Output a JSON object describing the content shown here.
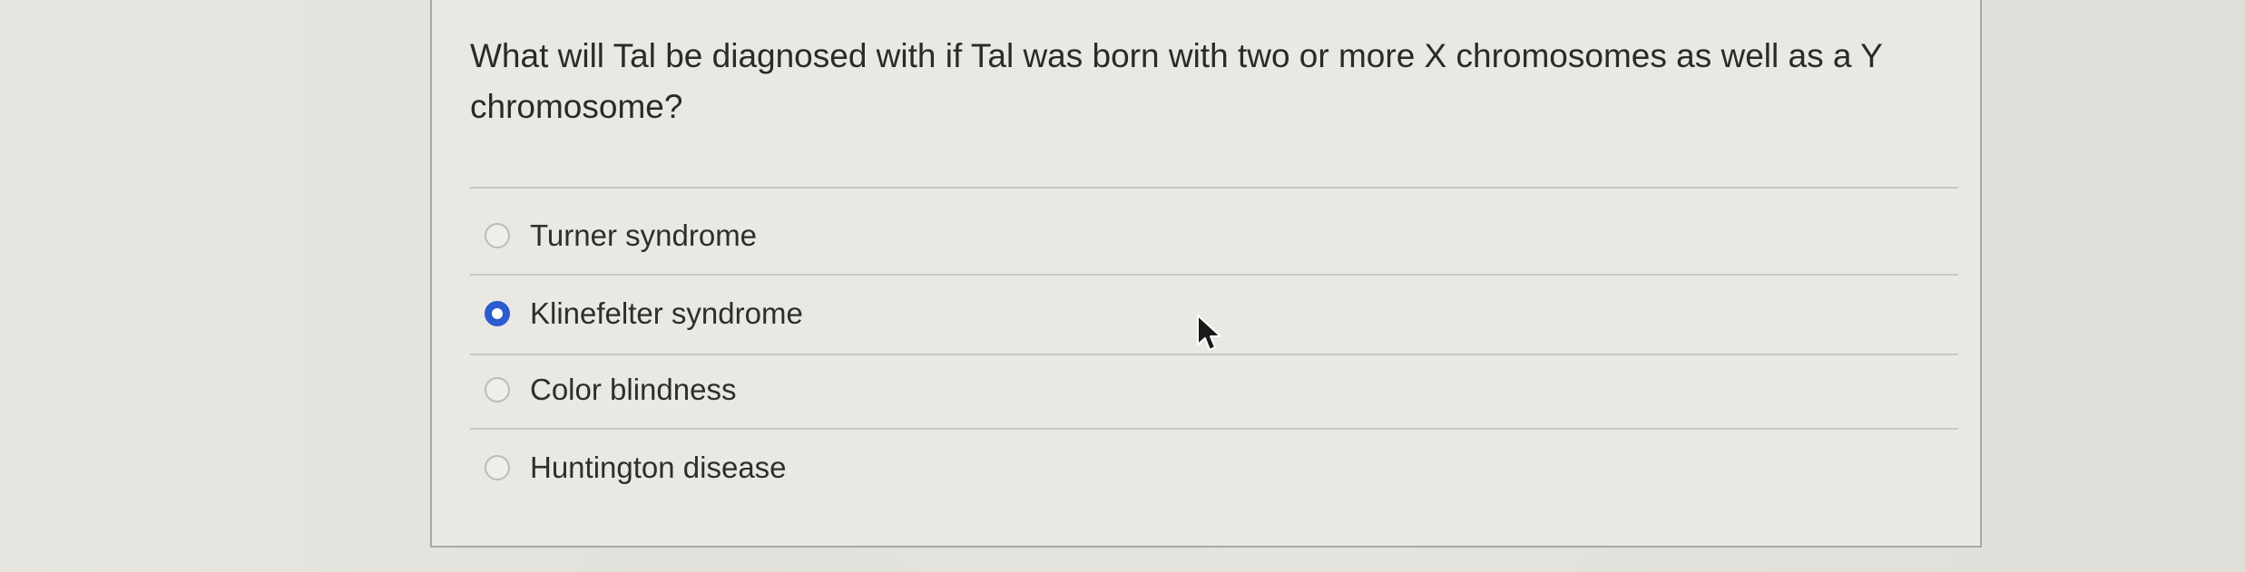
{
  "question": {
    "text": "What will Tal be diagnosed with if Tal was born with two or more X chromosomes as well as a Y chromosome?"
  },
  "options": [
    {
      "label": "Turner syndrome",
      "selected": false
    },
    {
      "label": "Klinefelter syndrome",
      "selected": true
    },
    {
      "label": "Color blindness",
      "selected": false
    },
    {
      "label": "Huntington disease",
      "selected": false
    }
  ],
  "colors": {
    "accent": "#2b5bd0",
    "text": "#2a2a2a",
    "card_border": "#a9a8a4",
    "divider": "#c8c7c2"
  },
  "icons": {
    "cursor": "mouse-pointer-icon",
    "radio": "radio-button-icon"
  }
}
